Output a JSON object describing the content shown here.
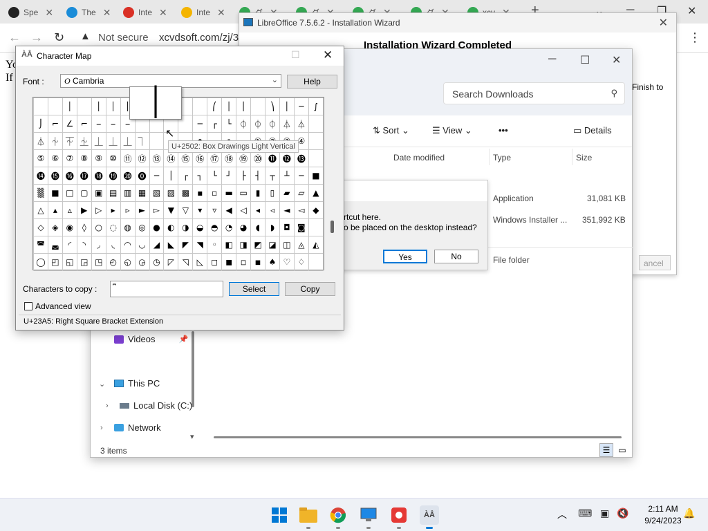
{
  "browser": {
    "tabs": [
      {
        "label": "Spe",
        "color": "#222222"
      },
      {
        "label": "The",
        "color": "#1a8cd8"
      },
      {
        "label": "Inte",
        "color": "#d93025"
      },
      {
        "label": "Inte",
        "color": "#f4b400"
      },
      {
        "label": "ダ",
        "color": "#34a853"
      },
      {
        "label": "ダ",
        "color": "#34a853"
      },
      {
        "label": "ダ",
        "color": "#34a853"
      },
      {
        "label": "ダ",
        "color": "#34a853"
      },
      {
        "label": "xcv",
        "color": "#34a853"
      }
    ],
    "new_tab": "+",
    "security_label": "Not secure",
    "url": "xcvdsoft.com/zj/36/",
    "page_text": [
      "Yo",
      "If"
    ]
  },
  "lo_wizard": {
    "title": "LibreOffice 7.5.6.2 - Installation Wizard",
    "heading": "Installation Wizard Completed",
    "side_text": "Finish to",
    "cancel_label": "ancel"
  },
  "explorer": {
    "search_placeholder": "Search Downloads",
    "toolbar": {
      "sort": "Sort",
      "view": "View",
      "more": "•••",
      "details": "Details"
    },
    "columns": [
      "Date modified",
      "Type",
      "Size"
    ],
    "rows": [
      {
        "type": "Application",
        "size": "31,081 KB"
      },
      {
        "type": "Windows Installer ...",
        "size": "351,992 KB"
      },
      {
        "type": "File folder",
        "size": ""
      }
    ],
    "nav": {
      "videos": "Videos",
      "this_pc": "This PC",
      "local_disk": "Local Disk (C:)",
      "network": "Network"
    },
    "status": "3 items"
  },
  "dialog": {
    "line1": "rtcut here.",
    "line2": "o be placed on the desktop instead?",
    "yes": "Yes",
    "no": "No"
  },
  "charmap": {
    "title": "Character Map",
    "font_label": "Font :",
    "font_value": "Cambria",
    "help": "Help",
    "zoom_char": "│",
    "tooltip": "U+2502: Box Drawings Light Vertical",
    "copy_label": "Characters to copy :",
    "copy_value": "⎴",
    "select": "Select",
    "copy": "Copy",
    "advanced": "Advanced view",
    "status": "U+23A5: Right Square Bracket Extension",
    "grid": [
      [
        "",
        "",
        "│",
        "",
        "│",
        "│",
        "│",
        "",
        "",
        "",
        "",
        "",
        "⎛",
        "│",
        "│",
        "",
        "⎞",
        "│",
        "─",
        "∫"
      ],
      [
        "⌡",
        "⌐",
        "∠",
        "⌐",
        "⎯",
        "⎯",
        "⎯",
        "",
        "",
        "",
        "",
        "─",
        "┌",
        "└",
        "⏀",
        "⏀",
        "⏀",
        "⏃",
        "⏃",
        ""
      ],
      [
        "⏃",
        "⏆",
        "⏇",
        "⏈",
        "⏊",
        "⏊",
        "⏊",
        "⏋",
        "",
        "",
        "",
        "⏏",
        "⏑",
        "⏒",
        "⏓",
        "①",
        "②",
        "③",
        "④",
        ""
      ],
      [
        "⑤",
        "⑥",
        "⑦",
        "⑧",
        "⑨",
        "⑩",
        "⑪",
        "⑫",
        "⑬",
        "⑭",
        "⑮",
        "⑯",
        "⑰",
        "⑱",
        "⑲",
        "⑳",
        "⓫",
        "⓬",
        "⓭",
        ""
      ],
      [
        "⓮",
        "⓯",
        "⓰",
        "⓱",
        "⓲",
        "⓳",
        "⓴",
        "⓿",
        "─",
        "│",
        "┌",
        "┐",
        "└",
        "┘",
        "├",
        "┤",
        "┬",
        "┴",
        "─",
        "■"
      ],
      [
        "▒",
        "■",
        "□",
        "▢",
        "▣",
        "▤",
        "▥",
        "▦",
        "▧",
        "▨",
        "▩",
        "▪",
        "▫",
        "▬",
        "▭",
        "▮",
        "▯",
        "▰",
        "▱",
        "▲"
      ],
      [
        "△",
        "▴",
        "▵",
        "▶",
        "▷",
        "▸",
        "▹",
        "►",
        "▻",
        "▼",
        "▽",
        "▾",
        "▿",
        "◀",
        "◁",
        "◂",
        "◃",
        "◄",
        "◅",
        "◆"
      ],
      [
        "◇",
        "◈",
        "◉",
        "◊",
        "○",
        "◌",
        "◍",
        "◎",
        "●",
        "◐",
        "◑",
        "◒",
        "◓",
        "◔",
        "◕",
        "◖",
        "◗",
        "◘",
        "◙",
        ""
      ],
      [
        "◚",
        "◛",
        "◜",
        "◝",
        "◞",
        "◟",
        "◠",
        "◡",
        "◢",
        "◣",
        "◤",
        "◥",
        "◦",
        "◧",
        "◨",
        "◩",
        "◪",
        "◫",
        "◬",
        "◭"
      ],
      [
        "◯",
        "◰",
        "◱",
        "◲",
        "◳",
        "◴",
        "◵",
        "◶",
        "◷",
        "◸",
        "◹",
        "◺",
        "◻",
        "◼",
        "◽",
        "◾",
        "♠",
        "♡",
        "♢",
        ""
      ]
    ]
  },
  "taskbar": {
    "apps": [
      "windows-start",
      "file-explorer",
      "chrome",
      "remote-desktop",
      "app-red",
      "charmap"
    ],
    "time": "2:11 AM",
    "date": "9/24/2023"
  }
}
